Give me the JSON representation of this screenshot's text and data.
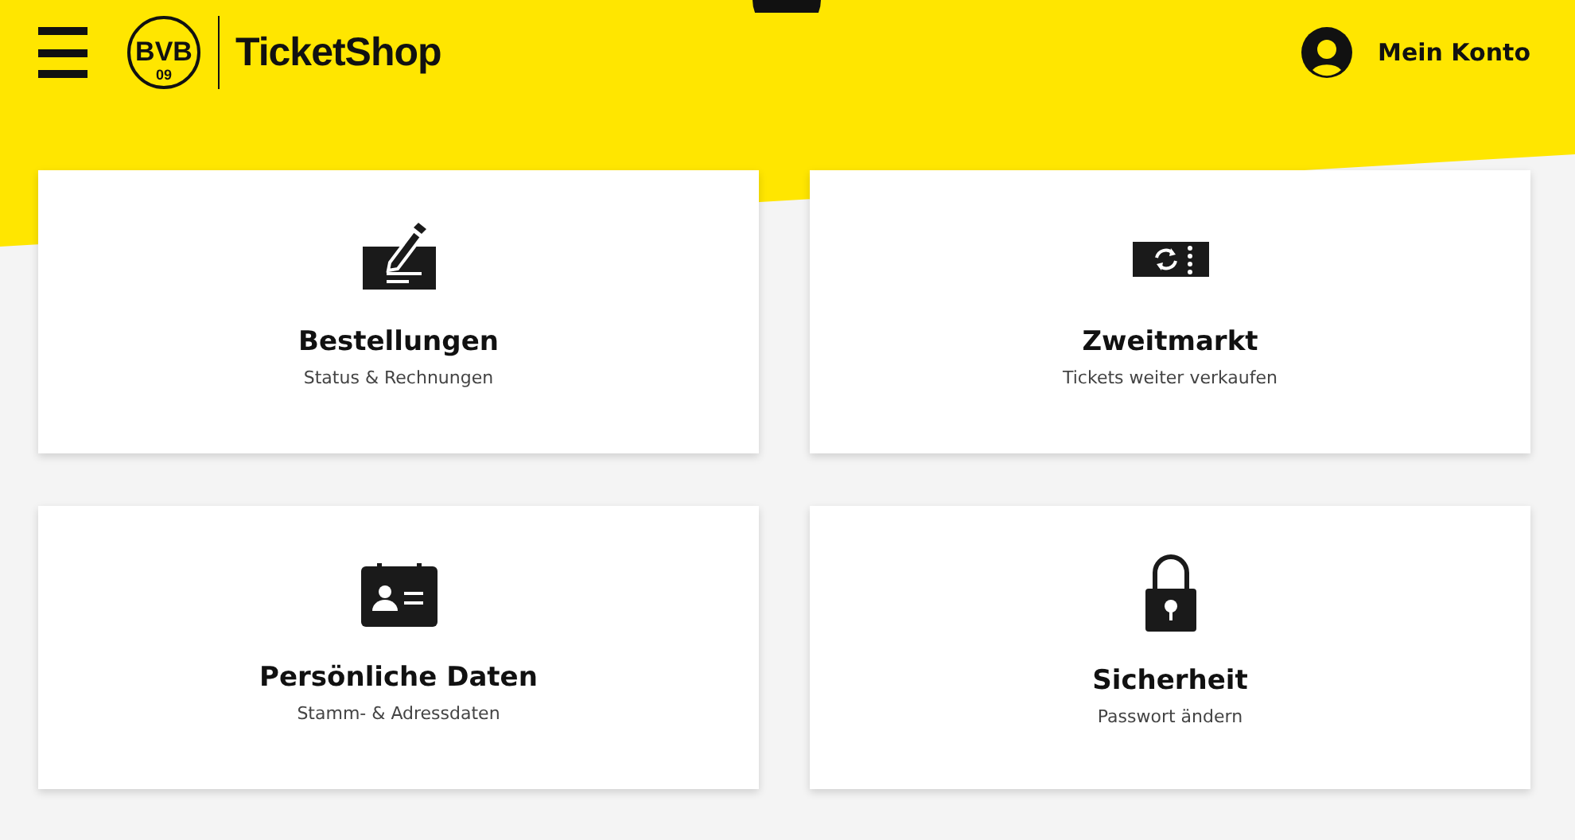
{
  "header": {
    "logo": {
      "letters": "BVB",
      "number": "09"
    },
    "brand": "TicketShop",
    "account": "Mein Konto"
  },
  "cards": [
    {
      "kind": "orders",
      "title": "Bestellungen",
      "subtitle": "Status & Rechnungen"
    },
    {
      "kind": "resale",
      "title": "Zweitmarkt",
      "subtitle": "Tickets weiter verkaufen"
    },
    {
      "kind": "personal",
      "title": "Persönliche Daten",
      "subtitle": "Stamm- & Adressdaten"
    },
    {
      "kind": "security",
      "title": "Sicherheit",
      "subtitle": "Passwort ändern"
    }
  ]
}
